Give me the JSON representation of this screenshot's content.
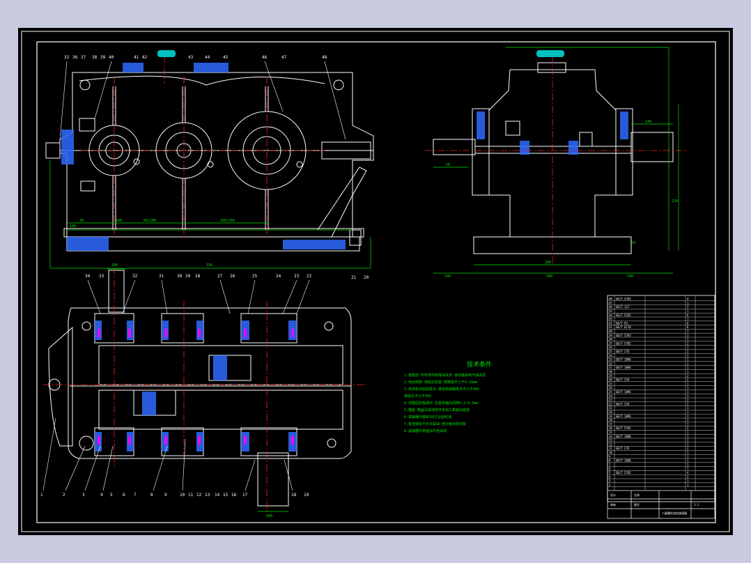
{
  "colors": {
    "background": "#c8cae0",
    "canvas": "#000000",
    "outline": "#ffffff",
    "centerline": "#ff2020",
    "dimension": "#00e000",
    "hatch": "#2f6bff",
    "section": "#ff00ff",
    "accent": "#00c0c0"
  },
  "front_view": {
    "callouts": [
      "32",
      "36",
      "37",
      "38",
      "39",
      "40",
      "41",
      "42",
      "43",
      "44",
      "45",
      "46",
      "47",
      "48",
      "21",
      "20"
    ],
    "dim_labels": [
      "140",
      "66/100",
      "100/160",
      "330",
      "38",
      "100"
    ]
  },
  "side_view": {
    "dim_labels": [
      "140",
      "56",
      "120",
      "14",
      "280",
      "100",
      "300",
      "100"
    ]
  },
  "plan_view": {
    "callouts_top": [
      "34",
      "33",
      "32",
      "31",
      "30",
      "29",
      "28",
      "27",
      "26",
      "25",
      "24",
      "23",
      "22"
    ],
    "callouts_bottom": [
      "1",
      "2",
      "3",
      "4",
      "5",
      "6",
      "7",
      "8",
      "9",
      "10",
      "11",
      "12",
      "13",
      "14",
      "15",
      "16",
      "17",
      "18",
      "19"
    ],
    "dim_labels": [
      "100",
      "100"
    ]
  },
  "tech_notes": {
    "title": "技术条件",
    "lines": [
      "1.装配前 所有零件用煤油清洗 滚动轴承用汽油清洗",
      "2.啮合侧隙 用铅丝检验 侧隙值不小于0.16mm",
      "3.用涂色法检验斑点 按齿高接触斑点不小于40%",
      "  按齿长不小于50%",
      "4.调整固定轴承时 应留有轴向间隙0.2~0.3mm",
      "5.箱座 箱盖及其他零件未加工表面涂底漆",
      "6.减速器内装N220工业齿轮油",
      "7.各连接处不允许漏油 剖分面涂密封胶",
      "8.减速器外表面涂灰色油漆"
    ]
  },
  "title_block": {
    "title": "二级圆柱齿轮减速器",
    "labels": [
      "设计",
      "审核",
      "比例",
      "图号",
      "1:1"
    ]
  },
  "bom": {
    "rows": [
      {
        "no": "48",
        "std": "GB/T 5783",
        "qty": "4"
      },
      {
        "no": "47",
        "std": "",
        "qty": "1"
      },
      {
        "no": "46",
        "std": "GB/T 117",
        "qty": "2"
      },
      {
        "no": "45",
        "std": "",
        "qty": "1"
      },
      {
        "no": "44",
        "std": "GB/T 5782",
        "qty": "6"
      },
      {
        "no": "43",
        "std": "",
        "qty": "1"
      },
      {
        "no": "42",
        "std": "GB/T 93",
        "qty": "6"
      },
      {
        "no": "41",
        "std": "GB/T 6170",
        "qty": "6"
      },
      {
        "no": "40",
        "std": "",
        "qty": "1"
      },
      {
        "no": "39",
        "std": "GB/T 5783",
        "qty": "1"
      },
      {
        "no": "38",
        "std": "",
        "qty": "1"
      },
      {
        "no": "37",
        "std": "GB/T 5782",
        "qty": "2"
      },
      {
        "no": "36",
        "std": "",
        "qty": "1"
      },
      {
        "no": "35",
        "std": "GB/T 276",
        "qty": "2"
      },
      {
        "no": "34",
        "std": "",
        "qty": "1"
      },
      {
        "no": "33",
        "std": "GB/T 1096",
        "qty": "1"
      },
      {
        "no": "32",
        "std": "",
        "qty": "1"
      },
      {
        "no": "31",
        "std": "GB/T 1096",
        "qty": "1"
      },
      {
        "no": "30",
        "std": "",
        "qty": "1"
      },
      {
        "no": "29",
        "std": "",
        "qty": "2"
      },
      {
        "no": "28",
        "std": "GB/T 276",
        "qty": "2"
      },
      {
        "no": "27",
        "std": "",
        "qty": "1"
      },
      {
        "no": "26",
        "std": "",
        "qty": "1"
      },
      {
        "no": "25",
        "std": "GB/T 1096",
        "qty": "1"
      },
      {
        "no": "24",
        "std": "",
        "qty": "1"
      },
      {
        "no": "23",
        "std": "",
        "qty": "2"
      },
      {
        "no": "22",
        "std": "GB/T 276",
        "qty": "2"
      },
      {
        "no": "21",
        "std": "",
        "qty": "1"
      },
      {
        "no": "20",
        "std": "",
        "qty": "1"
      },
      {
        "no": "19",
        "std": "GB/T 1096",
        "qty": "1"
      },
      {
        "no": "18",
        "std": "",
        "qty": "1"
      },
      {
        "no": "17",
        "std": "",
        "qty": "1"
      },
      {
        "no": "16",
        "std": "GB/T 5782",
        "qty": "2"
      },
      {
        "no": "15",
        "std": "",
        "qty": "1"
      },
      {
        "no": "14",
        "std": "GB/T 1096",
        "qty": "1"
      },
      {
        "no": "13",
        "std": "",
        "qty": "1"
      },
      {
        "no": "12",
        "std": "",
        "qty": "1"
      },
      {
        "no": "11",
        "std": "GB/T 276",
        "qty": "2"
      },
      {
        "no": "10",
        "std": "",
        "qty": "1"
      },
      {
        "no": "9",
        "std": "",
        "qty": "1"
      },
      {
        "no": "8",
        "std": "GB/T 1096",
        "qty": "1"
      },
      {
        "no": "7",
        "std": "",
        "qty": "1"
      },
      {
        "no": "6",
        "std": "",
        "qty": "1"
      },
      {
        "no": "5",
        "std": "GB/T 5782",
        "qty": "4"
      },
      {
        "no": "4",
        "std": "",
        "qty": "2"
      },
      {
        "no": "3",
        "std": "",
        "qty": "1"
      },
      {
        "no": "2",
        "std": "",
        "qty": "1"
      },
      {
        "no": "1",
        "std": "GB/T 5782",
        "qty": "2"
      }
    ]
  }
}
